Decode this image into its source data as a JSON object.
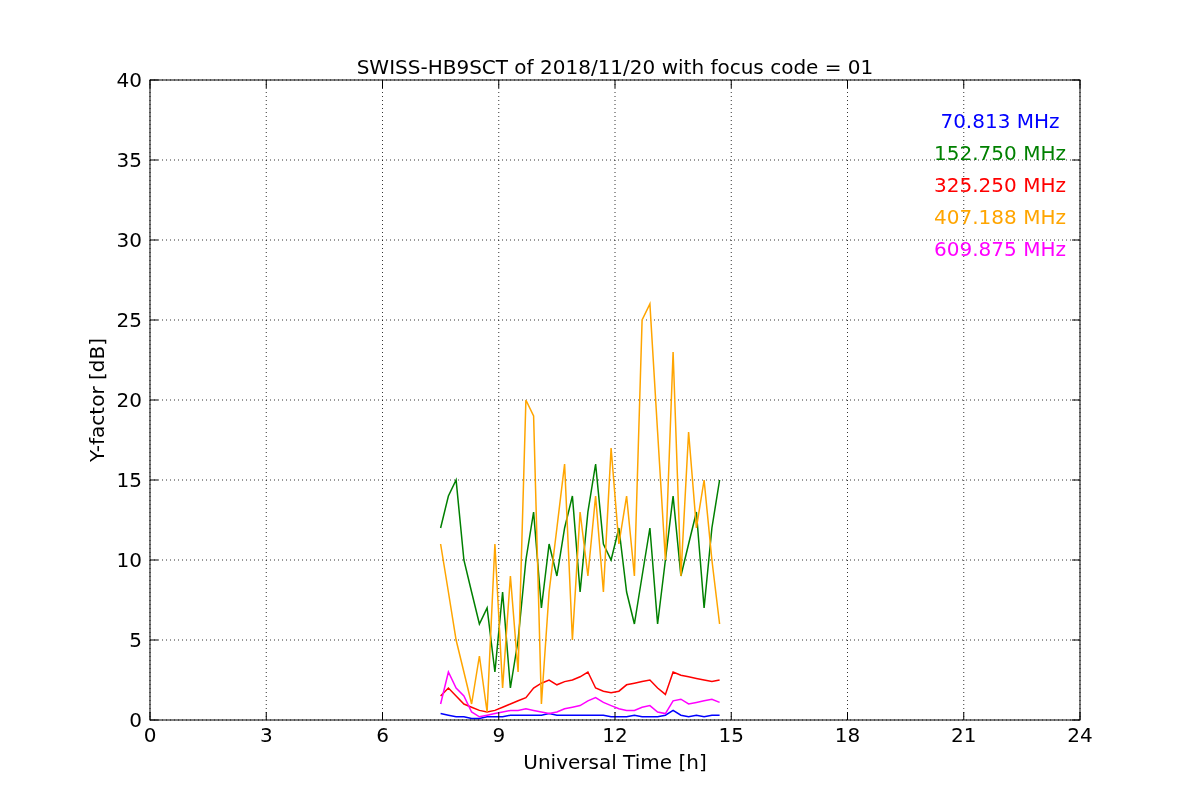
{
  "chart_data": {
    "type": "line",
    "title": "SWISS-HB9SCT of 2018/11/20 with focus code = 01",
    "xlabel": "Universal Time [h]",
    "ylabel": "Y-factor [dB]",
    "x": [
      7.5,
      7.7,
      7.9,
      8.1,
      8.3,
      8.5,
      8.7,
      8.9,
      9.1,
      9.3,
      9.5,
      9.7,
      9.9,
      10.1,
      10.3,
      10.5,
      10.7,
      10.9,
      11.1,
      11.3,
      11.5,
      11.7,
      11.9,
      12.1,
      12.3,
      12.5,
      12.7,
      12.9,
      13.1,
      13.3,
      13.5,
      13.7,
      13.9,
      14.1,
      14.3,
      14.5,
      14.7
    ],
    "grid": true,
    "xlim": [
      0,
      24
    ],
    "ylim": [
      0,
      40
    ],
    "xticks": [
      0,
      3,
      6,
      9,
      12,
      15,
      18,
      21,
      24
    ],
    "yticks": [
      0,
      5,
      10,
      15,
      20,
      25,
      30,
      35,
      40
    ],
    "series": [
      {
        "name": "70.813 MHz",
        "color": "#0000ff",
        "values": [
          0.4,
          0.3,
          0.2,
          0.2,
          0.1,
          0.1,
          0.2,
          0.2,
          0.2,
          0.3,
          0.3,
          0.3,
          0.3,
          0.3,
          0.4,
          0.3,
          0.3,
          0.3,
          0.3,
          0.3,
          0.3,
          0.3,
          0.2,
          0.2,
          0.2,
          0.3,
          0.2,
          0.2,
          0.2,
          0.3,
          0.6,
          0.3,
          0.2,
          0.3,
          0.2,
          0.3,
          0.3
        ]
      },
      {
        "name": "152.750 MHz",
        "color": "#008000",
        "values": [
          12,
          14,
          15,
          10,
          8,
          6,
          7,
          3,
          8,
          2,
          5,
          10,
          13,
          7,
          11,
          9,
          12,
          14,
          8,
          13,
          16,
          11,
          10,
          12,
          8,
          6,
          9,
          12,
          6,
          10,
          14,
          9,
          11,
          13,
          7,
          12,
          15
        ]
      },
      {
        "name": "325.250 MHz",
        "color": "#ff0000",
        "values": [
          1.5,
          2,
          1.5,
          1,
          0.8,
          0.6,
          0.5,
          0.6,
          0.8,
          1,
          1.2,
          1.4,
          2,
          2.3,
          2.5,
          2.2,
          2.4,
          2.5,
          2.7,
          3,
          2,
          1.8,
          1.7,
          1.8,
          2.2,
          2.3,
          2.4,
          2.5,
          2,
          1.6,
          3,
          2.8,
          2.7,
          2.6,
          2.5,
          2.4,
          2.5
        ]
      },
      {
        "name": "407.188 MHz",
        "color": "#ffa500",
        "values": [
          11,
          8,
          5,
          3,
          1,
          4,
          0.5,
          11,
          2,
          9,
          3,
          20,
          19,
          1,
          8,
          12,
          16,
          5,
          13,
          9,
          14,
          8,
          17,
          11,
          14,
          9,
          25,
          26,
          18,
          10,
          23,
          9,
          18,
          12,
          15,
          10,
          6
        ]
      },
      {
        "name": "609.875 MHz",
        "color": "#ff00ff",
        "values": [
          1,
          3,
          2,
          1.5,
          0.5,
          0.2,
          0.3,
          0.4,
          0.5,
          0.6,
          0.6,
          0.7,
          0.6,
          0.5,
          0.4,
          0.5,
          0.7,
          0.8,
          0.9,
          1.2,
          1.4,
          1.1,
          0.9,
          0.7,
          0.6,
          0.6,
          0.8,
          0.9,
          0.5,
          0.4,
          1.2,
          1.3,
          1,
          1.1,
          1.2,
          1.3,
          1.1
        ]
      }
    ]
  }
}
